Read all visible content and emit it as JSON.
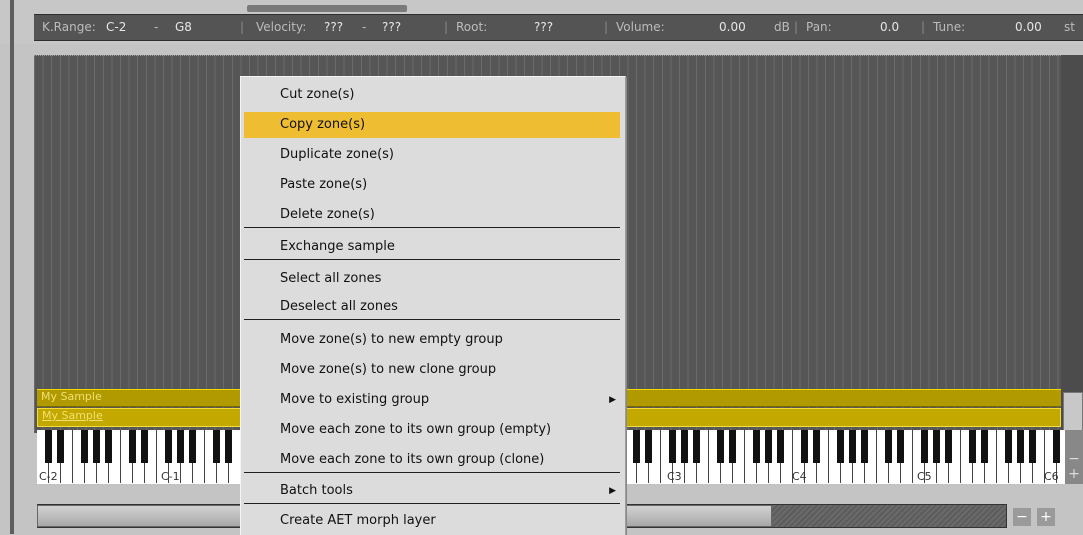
{
  "param_bar": {
    "krange_label": "K.Range:",
    "krange_low": "C-2",
    "krange_dash": "-",
    "krange_high": "G8",
    "sep": "|",
    "velocity_label": "Velocity:",
    "velocity_low": "???",
    "velocity_dash": "-",
    "velocity_high": "???",
    "root_label": "Root:",
    "root_value": "???",
    "volume_label": "Volume:",
    "volume_value": "0.00",
    "volume_unit": "dB",
    "pan_label": "Pan:",
    "pan_value": "0.0",
    "tune_label": "Tune:",
    "tune_value": "0.00",
    "tune_unit": "st"
  },
  "zones": [
    {
      "label": "My Sample"
    },
    {
      "label": "My Sample"
    }
  ],
  "keyboard": {
    "octave_labels": [
      "C-2",
      "C-1",
      "C3",
      "C4",
      "C5",
      "C6"
    ],
    "minus": "−",
    "plus": "+"
  },
  "zoom": {
    "minus": "−",
    "plus": "+"
  },
  "menu": {
    "items": [
      {
        "label": "Cut zone(s)"
      },
      {
        "label": "Copy zone(s)"
      },
      {
        "label": "Duplicate zone(s)"
      },
      {
        "label": "Paste zone(s)"
      },
      {
        "label": "Delete zone(s)"
      },
      {
        "label": "Exchange sample"
      },
      {
        "label": "Select all zones"
      },
      {
        "label": "Deselect all zones"
      },
      {
        "label": "Move zone(s) to new empty group"
      },
      {
        "label": "Move zone(s) to new clone group"
      },
      {
        "label": "Move to existing group",
        "arrow": "▶"
      },
      {
        "label": "Move each zone to its own group (empty)"
      },
      {
        "label": "Move each zone to its own group (clone)"
      },
      {
        "label": "Batch tools",
        "arrow": "▶"
      },
      {
        "label": "Create AET morph layer"
      }
    ]
  },
  "colors": {
    "highlight": "#efbd32",
    "zone": "#b09a00",
    "grid": "#565656"
  }
}
